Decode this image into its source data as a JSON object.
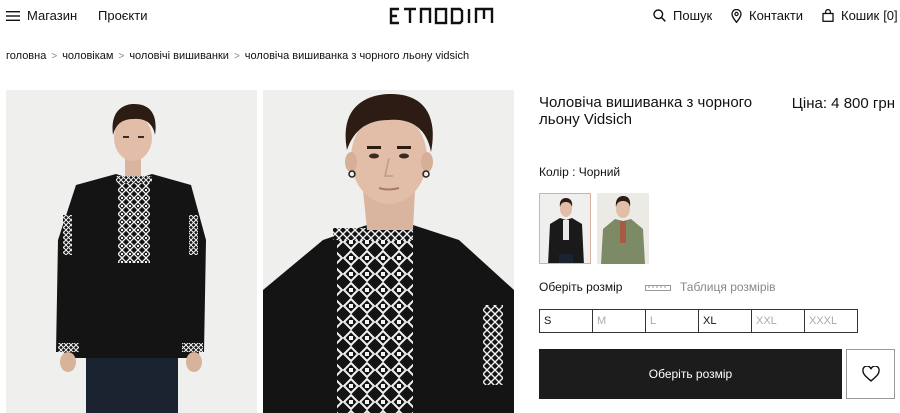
{
  "header": {
    "menu_label": "Магазин",
    "projects_label": "Проєкти",
    "logo_text": "ETNODIM",
    "search_label": "Пошук",
    "contacts_label": "Контакти",
    "cart_label": "Кошик",
    "cart_count": "[0]"
  },
  "breadcrumb": [
    "головна",
    "чоловікам",
    "чоловічі вишиванки",
    "чоловіча вишиванка з чорного льону vidsich"
  ],
  "product": {
    "title": "Чоловіча вишиванка з чорного льону Vidsich",
    "price": "Ціна: 4 800 грн",
    "color_label": "Колір : Чорний",
    "color_swatches": [
      {
        "name": "black",
        "color": "#1a1a1a"
      },
      {
        "name": "green",
        "color": "#7d8a66"
      }
    ],
    "size_prompt": "Оберіть розмір",
    "size_table_label": "Таблиця розмірів",
    "sizes": [
      {
        "label": "S",
        "available": true
      },
      {
        "label": "M",
        "available": false
      },
      {
        "label": "L",
        "available": false
      },
      {
        "label": "XL",
        "available": true
      },
      {
        "label": "XXL",
        "available": false
      },
      {
        "label": "XXXL",
        "available": false
      }
    ],
    "cta_label": "Оберіть розмір",
    "wishlist_icon": "heart-icon"
  },
  "colors": {
    "cta_bg": "#1c1c1c",
    "photo_bg": "#efefed",
    "shirt": "#141414",
    "embroidery": "#f2f2f2"
  }
}
